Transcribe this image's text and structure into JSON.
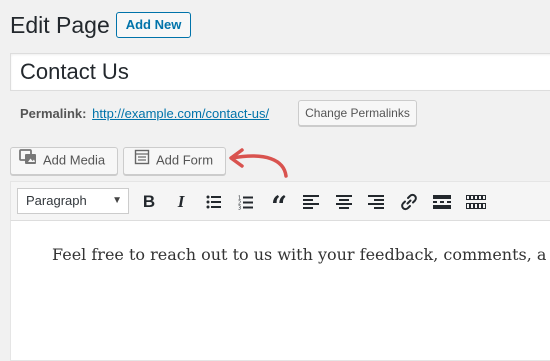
{
  "header": {
    "title": "Edit Page",
    "add_new_label": "Add New"
  },
  "title_field": {
    "value": "Contact Us"
  },
  "permalink": {
    "label": "Permalink:",
    "url": "http://example.com/contact-us/",
    "change_label": "Change Permalinks"
  },
  "media_buttons": {
    "add_media_label": "Add Media",
    "add_form_label": "Add Form"
  },
  "toolbar": {
    "format_value": "Paragraph",
    "buttons": [
      "bold-icon",
      "italic-icon",
      "bullet-list-icon",
      "numbered-list-icon",
      "blockquote-icon",
      "align-left-icon",
      "align-center-icon",
      "align-right-icon",
      "link-icon",
      "read-more-icon",
      "toolbar-toggle-icon"
    ]
  },
  "editor": {
    "content": "Feel free to reach out to us with your feedback, comments, a"
  },
  "colors": {
    "link": "#0073aa",
    "annotation_arrow": "#d9534f"
  }
}
